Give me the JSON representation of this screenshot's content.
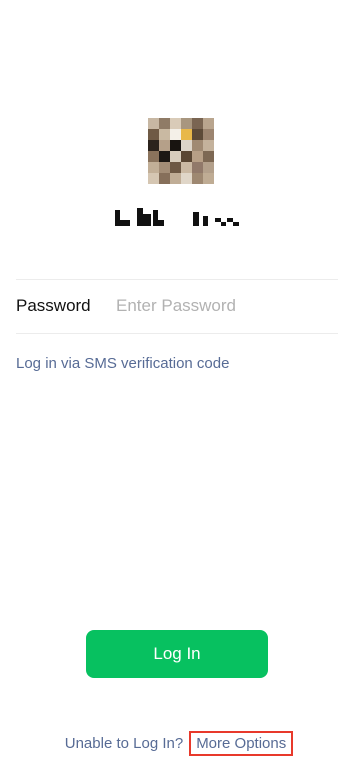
{
  "profile": {
    "avatar_colors": [
      "#c7b7a3",
      "#8f7b66",
      "#d9cbb8",
      "#a8967f",
      "#7a6552",
      "#b9a58e",
      "#6f5a45",
      "#c9b9a2",
      "#f4f0e8",
      "#e8b84a",
      "#5c4a38",
      "#9c8570",
      "#2b231c",
      "#b5a089",
      "#181410",
      "#dcd4c8",
      "#a08a73",
      "#c4b29c",
      "#8a735c",
      "#1d1814",
      "#d8cdbd",
      "#5a4633",
      "#b79f86",
      "#7d6853",
      "#c2af97",
      "#a38d76",
      "#6d5844",
      "#cbb9a3",
      "#91796a",
      "#b3a08b",
      "#d5c6b2",
      "#866f5a",
      "#c0ad96",
      "#e0d6c8",
      "#9e8871",
      "#bfac94"
    ]
  },
  "password": {
    "label": "Password",
    "placeholder": "Enter Password"
  },
  "sms_login": {
    "label": "Log in via SMS verification code"
  },
  "login_button": {
    "label": "Log In"
  },
  "bottom": {
    "unable_label": "Unable to Log In?",
    "more_options_label": "More Options"
  }
}
